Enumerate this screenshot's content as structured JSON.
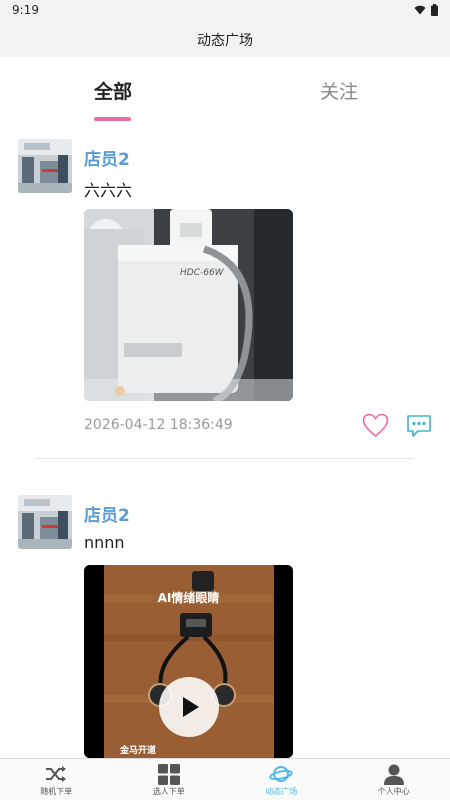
{
  "status_bar": {
    "time": "9:19"
  },
  "header": {
    "title": "动态广场"
  },
  "tabs": [
    {
      "label": "全部",
      "active": true
    },
    {
      "label": "关注",
      "active": false
    }
  ],
  "posts": [
    {
      "author": "店员2",
      "text": "六六六",
      "media_type": "image",
      "timestamp": "2026-04-12 18:36:49"
    },
    {
      "author": "店员2",
      "text": "nnnn",
      "media_type": "video",
      "video_caption": "AI情绪眼睛",
      "video_subcaption": "金马开道"
    }
  ],
  "bottom_nav": [
    {
      "label": "随机下单",
      "icon": "shuffle-icon"
    },
    {
      "label": "选人下单",
      "icon": "grid-icon"
    },
    {
      "label": "动态广场",
      "icon": "planet-icon",
      "active": true
    },
    {
      "label": "个人中心",
      "icon": "person-icon"
    }
  ],
  "colors": {
    "accent_pink": "#ee6aa4",
    "author_blue": "#5b9bd5",
    "nav_active": "#4fb6e8",
    "comment_teal": "#3fb5c9"
  }
}
